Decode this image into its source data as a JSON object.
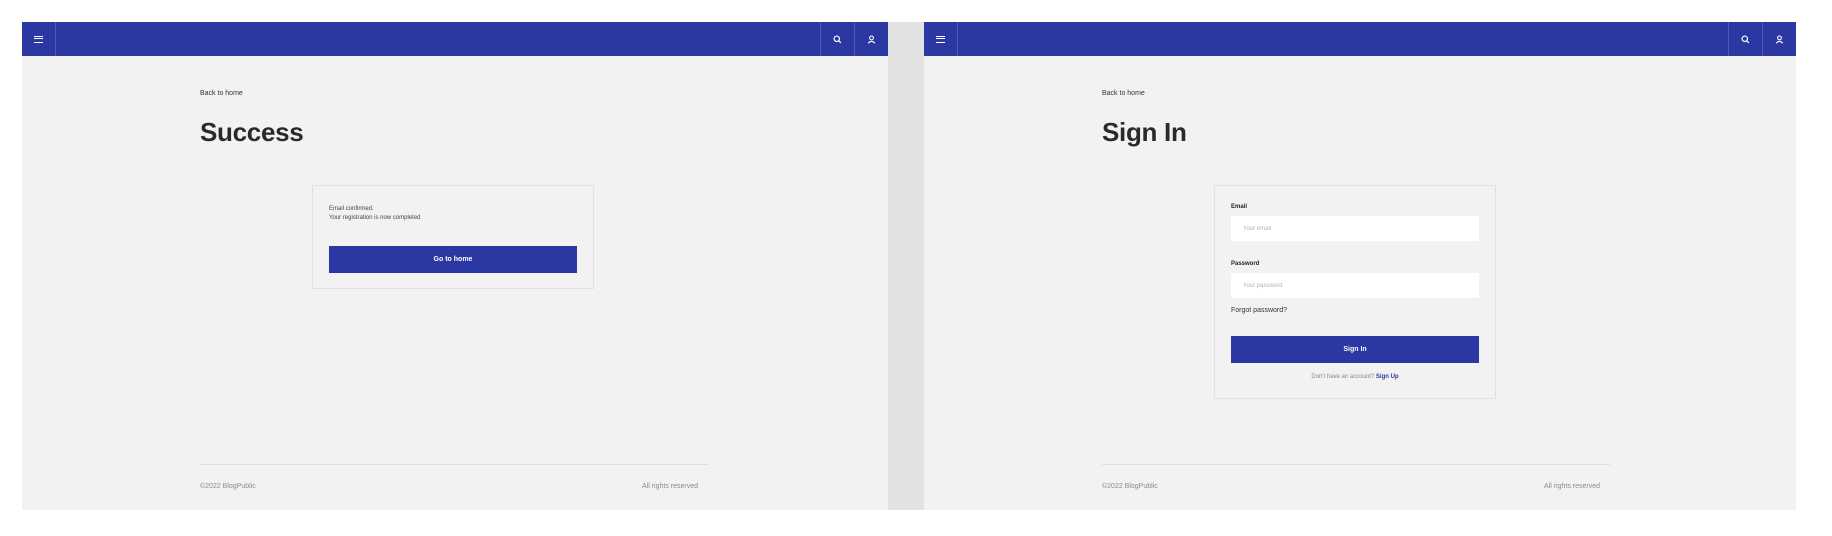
{
  "screens": [
    {
      "topbar": {
        "menu_icon": "menu-icon",
        "search_icon": "search-icon",
        "user_icon": "user-icon"
      },
      "back_link": "Back to home",
      "title": "Success",
      "card": {
        "line1": "Email confirmed.",
        "line2": "Your registration is now completed",
        "button_label": "Go to home"
      },
      "footer": {
        "copyright": "©2022 BlogPublic",
        "rights": "All rights reserved"
      }
    },
    {
      "topbar": {
        "menu_icon": "menu-icon",
        "search_icon": "search-icon",
        "user_icon": "user-icon"
      },
      "back_link": "Back to home",
      "title": "Sign In",
      "form": {
        "email_label": "Email",
        "email_placeholder": "Your email",
        "email_value": "",
        "password_label": "Password",
        "password_placeholder": "Your password",
        "password_value": "",
        "forgot_label": "Forgot password?",
        "submit_label": "Sign In",
        "signup_prompt": "Don't have an account?",
        "signup_link": "Sign Up"
      },
      "footer": {
        "copyright": "©2022 BlogPublic",
        "rights": "All rights reserved"
      }
    }
  ],
  "colors": {
    "primary": "#2b37a3",
    "page_bg": "#f2f2f3",
    "divider_strip": "#e2e2e2"
  }
}
